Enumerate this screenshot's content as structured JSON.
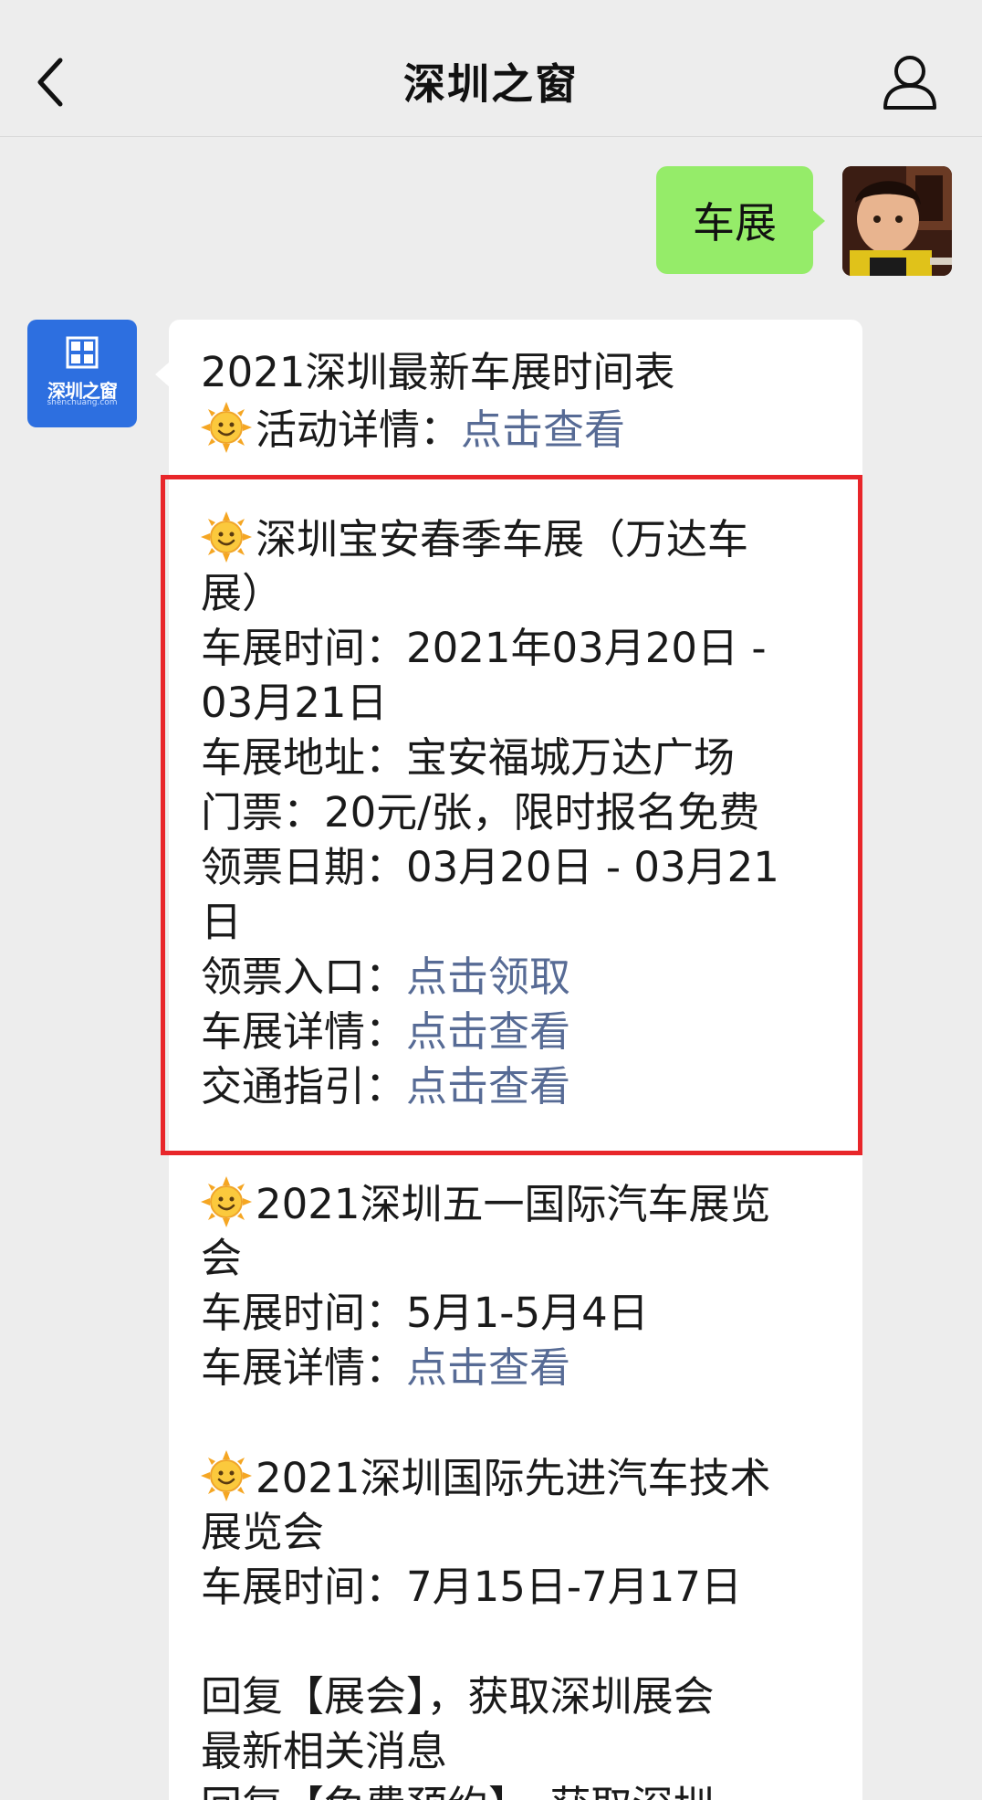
{
  "nav": {
    "title": "深圳之窗"
  },
  "outgoing": {
    "text": "车展"
  },
  "brand": {
    "logo_text": "深圳之窗",
    "logo_sub": "shenchuang.com"
  },
  "message": {
    "heading": "2021深圳最新车展时间表",
    "activity_label": "活动详情：",
    "activity_link": "点击查看",
    "section1": {
      "title_a": "深圳宝安春季车展（万达车",
      "title_b": "展）",
      "time_a": "车展时间：2021年03月20日 -",
      "time_b": "03月21日",
      "address": "车展地址：宝安福城万达广场",
      "ticket": "门票：20元/张，限时报名免费",
      "claim_date_a": "领票日期：03月20日 - 03月21",
      "claim_date_b": "日",
      "entry_label": "领票入口：",
      "entry_link": "点击领取",
      "detail_label": "车展详情：",
      "detail_link": "点击查看",
      "traffic_label": "交通指引：",
      "traffic_link": "点击查看"
    },
    "section2": {
      "title_a": "2021深圳五一国际汽车展览",
      "title_b": "会",
      "time": "车展时间：5月1-5月4日",
      "detail_label": "车展详情：",
      "detail_link": "点击查看"
    },
    "section3": {
      "title_a": "2021深圳国际先进汽车技术",
      "title_b": "展览会",
      "time": "车展时间：7月15日-7月17日"
    },
    "reply1_a": "回复【展会】，获取深圳展会",
    "reply1_b": "最新相关消息",
    "reply2_partial": "回复【免费预约】，获取深圳"
  }
}
